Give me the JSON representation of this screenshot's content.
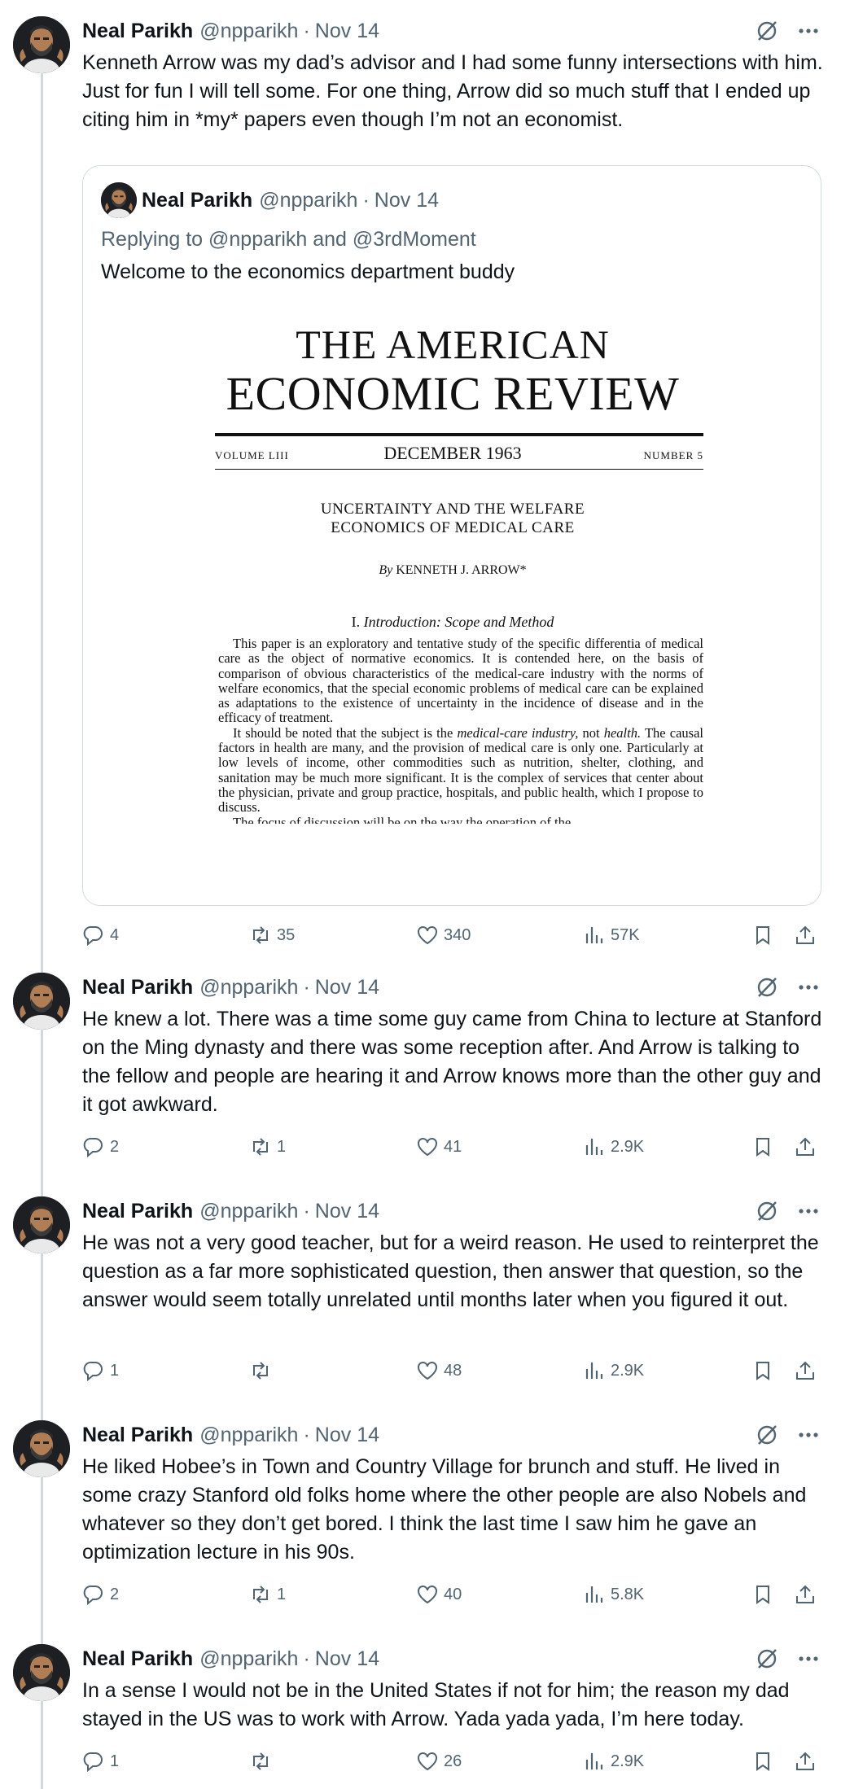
{
  "author": {
    "name": "Neal Parikh",
    "handle": "@npparikh",
    "separator": "·"
  },
  "icons": {
    "grok": "grok-icon",
    "more": "more-icon",
    "reply": "reply-icon",
    "retweet": "retweet-icon",
    "like": "heart-icon",
    "views": "views-icon",
    "bookmark": "bookmark-icon",
    "share": "share-icon"
  },
  "colors": {
    "text": "#0f1419",
    "muted": "#536471",
    "border": "#cfd9de"
  },
  "tweets": [
    {
      "date": "Nov 14",
      "text": "Kenneth Arrow was my dad’s advisor and I had some funny intersections with him. Just for fun I will tell some. For one thing, Arrow did so much stuff that I ended up citing him in *my* papers even though I’m not an economist.",
      "metrics": {
        "replies": "4",
        "retweets": "35",
        "likes": "340",
        "views": "57K"
      },
      "quote": {
        "name": "Neal Parikh",
        "handle": "@npparikh",
        "date": "Nov 14",
        "replying_to": "Replying to @npparikh and @3rdMoment",
        "text": "Welcome to the economics department buddy",
        "image": {
          "journal_line1": "THE AMERICAN",
          "journal_line2": "ECONOMIC REVIEW",
          "volume": "VOLUME LIII",
          "issue_date": "DECEMBER 1963",
          "number": "NUMBER 5",
          "article_title_line1": "UNCERTAINTY AND THE WELFARE",
          "article_title_line2": "ECONOMICS OF MEDICAL CARE",
          "by": "By",
          "author": "KENNETH J. ARROW*",
          "section_number": "I.",
          "section_title": "Introduction: Scope and Method",
          "paragraph1": "This paper is an exploratory and tentative study of the specific differentia of medical care as the object of normative economics. It is contended here, on the basis of comparison of obvious characteristics of the medical-care industry with the norms of welfare economics, that the special economic problems of medical care can be explained as adaptations to the existence of uncertainty in the incidence of disease and in the efficacy of treatment.",
          "paragraph2_a": "It should be noted that the subject is the ",
          "paragraph2_em1": "medical-care industry,",
          "paragraph2_b": " not ",
          "paragraph2_em2": "health.",
          "paragraph2_c": " The causal factors in health are many, and the provision of medical care is only one. Particularly at low levels of income, other commodities such as nutrition, shelter, clothing, and sanitation may be much more significant. It is the complex of services that center about the physician, private and group practice, hospitals, and public health, which I propose to discuss.",
          "paragraph3_partial": "The focus of discussion will be on the way the operation of the"
        }
      }
    },
    {
      "date": "Nov 14",
      "text": "He knew a lot. There was a time some guy came from China to lecture at Stanford on the Ming dynasty and there was some reception after. And Arrow is talking to the fellow and people are hearing it and Arrow knows more than the other guy and it got awkward.",
      "metrics": {
        "replies": "2",
        "retweets": "1",
        "likes": "41",
        "views": "2.9K"
      }
    },
    {
      "date": "Nov 14",
      "text": "He was not a very good teacher, but for a weird reason. He used to reinterpret the question as a far more sophisticated question, then answer that question, so the answer would seem totally unrelated until months later when you figured it out.",
      "metrics": {
        "replies": "1",
        "retweets": "",
        "likes": "48",
        "views": "2.9K"
      }
    },
    {
      "date": "Nov 14",
      "text": "He liked Hobee’s in Town and Country Village for brunch and stuff. He lived in some crazy Stanford old folks home where the other people are also Nobels and whatever so they don’t get bored. I think the last time I saw him he gave an optimization lecture in his 90s.",
      "metrics": {
        "replies": "2",
        "retweets": "1",
        "likes": "40",
        "views": "5.8K"
      }
    },
    {
      "date": "Nov 14",
      "text": "In a sense I would not be in the United States if not for him; the reason my dad stayed in the US was to work with Arrow. Yada yada yada, I’m here today.",
      "metrics": {
        "replies": "1",
        "retweets": "",
        "likes": "26",
        "views": "2.9K"
      }
    }
  ]
}
